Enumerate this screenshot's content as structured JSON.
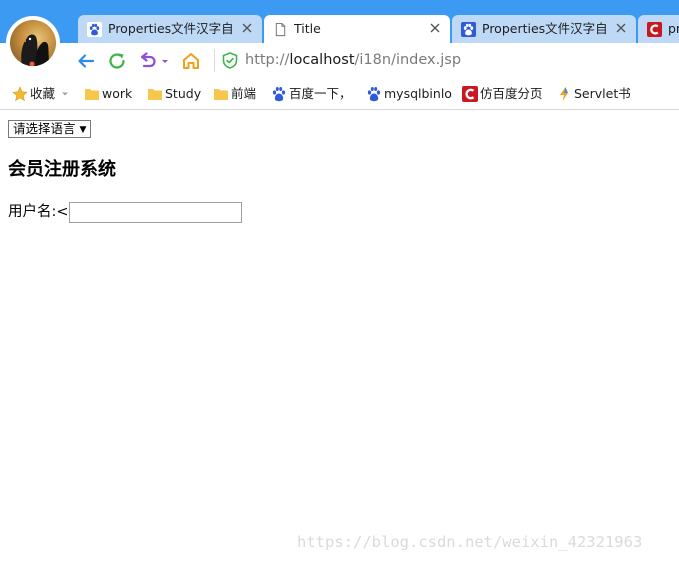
{
  "browser": {
    "tabs": [
      {
        "title": "Properties文件汉字自动",
        "icon": "baidu-paw-icon",
        "active": false
      },
      {
        "title": "Title",
        "icon": "document-icon",
        "active": true
      },
      {
        "title": "Properties文件汉字自动",
        "icon": "baidu-paw-icon",
        "active": false
      },
      {
        "title": "pr",
        "icon": "csdn-c-icon",
        "active": false
      }
    ],
    "address": {
      "scheme": "http://",
      "host": "localhost",
      "path": "/i18n/index.jsp"
    },
    "bookmarks": [
      {
        "label": "收藏",
        "icon": "star-icon"
      },
      {
        "label": "work",
        "icon": "folder-icon"
      },
      {
        "label": "Study",
        "icon": "folder-icon"
      },
      {
        "label": "前端",
        "icon": "folder-icon"
      },
      {
        "label": "百度一下，",
        "icon": "baidu-paw-icon"
      },
      {
        "label": "mysqlbinlo",
        "icon": "baidu-paw-icon"
      },
      {
        "label": "仿百度分页",
        "icon": "csdn-c-icon"
      },
      {
        "label": "Servlet书",
        "icon": "bolt-icon"
      }
    ]
  },
  "page": {
    "language_select": {
      "selected": "请选择语言"
    },
    "heading": "会员注册系统",
    "username_label": "用户名:<",
    "username_value": ""
  },
  "watermark": "https://blog.csdn.net/weixin_42321963",
  "colors": {
    "tabstrip": "#3d9af3",
    "tab_inactive": "#bdd9f6",
    "back_arrow": "#2a8be8",
    "refresh": "#3bb54a",
    "undo": "#8d50d6",
    "home": "#f0a01c",
    "shield": "#3bb54a",
    "folder": "#f7c64c",
    "csdn_red": "#c9181f"
  }
}
